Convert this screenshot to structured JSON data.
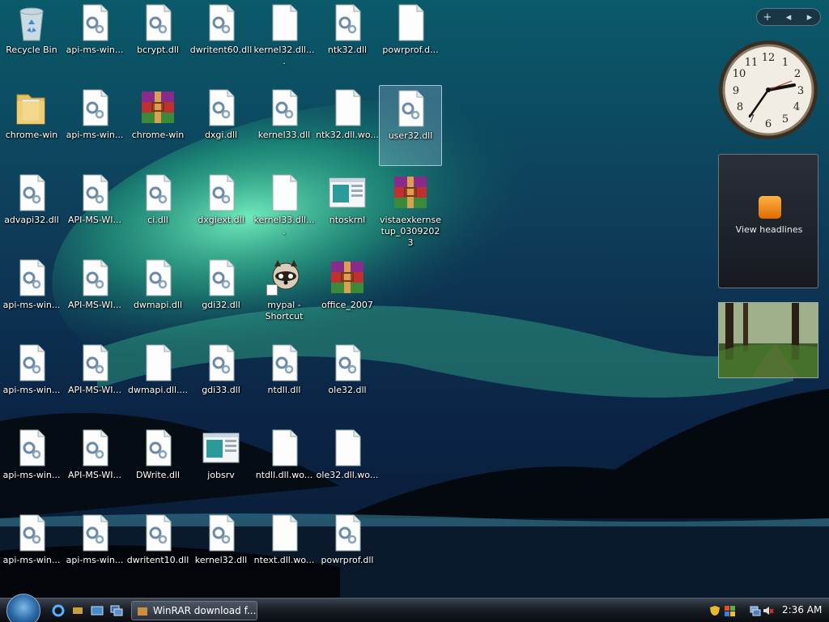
{
  "desktop": {
    "icons": [
      {
        "label": "Recycle Bin",
        "type": "recycle"
      },
      {
        "label": "api-ms-win...",
        "type": "dll"
      },
      {
        "label": "bcrypt.dll",
        "type": "dll"
      },
      {
        "label": "dwritent60.dll",
        "type": "dll"
      },
      {
        "label": "kernel32.dll....",
        "type": "blank"
      },
      {
        "label": "ntk32.dll",
        "type": "dll"
      },
      {
        "label": "powrprof.d...",
        "type": "blank"
      },
      {
        "label": "chrome-win",
        "type": "folder"
      },
      {
        "label": "api-ms-win...",
        "type": "dll"
      },
      {
        "label": "chrome-win",
        "type": "rar"
      },
      {
        "label": "dxgi.dll",
        "type": "dll"
      },
      {
        "label": "kernel33.dll",
        "type": "dll"
      },
      {
        "label": "ntk32.dll.wo...",
        "type": "blank"
      },
      {
        "label": "user32.dll",
        "type": "dll",
        "selected": true
      },
      {
        "label": "advapi32.dll",
        "type": "dll"
      },
      {
        "label": "API-MS-WI...",
        "type": "dll"
      },
      {
        "label": "ci.dll",
        "type": "dll"
      },
      {
        "label": "dxgiext.dll",
        "type": "dll"
      },
      {
        "label": "kernel33.dll....",
        "type": "blank"
      },
      {
        "label": "ntoskrnl",
        "type": "window"
      },
      {
        "label": "vistaexkernsetup_03092023",
        "type": "rar"
      },
      {
        "label": "api-ms-win...",
        "type": "dll"
      },
      {
        "label": "API-MS-WI...",
        "type": "dll"
      },
      {
        "label": "dwmapi.dll",
        "type": "dll"
      },
      {
        "label": "gdi32.dll",
        "type": "dll"
      },
      {
        "label": "mypal - Shortcut",
        "type": "raccoon"
      },
      {
        "label": "office_2007",
        "type": "rar"
      },
      {
        "label": "api-ms-win...",
        "type": "dll"
      },
      {
        "label": "API-MS-WI...",
        "type": "dll"
      },
      {
        "label": "dwmapi.dll....",
        "type": "blank"
      },
      {
        "label": "gdi33.dll",
        "type": "dll"
      },
      {
        "label": "ntdll.dll",
        "type": "dll"
      },
      {
        "label": "ole32.dll",
        "type": "dll"
      },
      {
        "label": "api-ms-win...",
        "type": "dll"
      },
      {
        "label": "API-MS-WI...",
        "type": "dll"
      },
      {
        "label": "DWrite.dll",
        "type": "dll"
      },
      {
        "label": "jobsrv",
        "type": "window"
      },
      {
        "label": "ntdll.dll.wo...",
        "type": "blank"
      },
      {
        "label": "ole32.dll.wo...",
        "type": "blank"
      },
      {
        "label": "api-ms-win...",
        "type": "dll"
      },
      {
        "label": "api-ms-win...",
        "type": "dll"
      },
      {
        "label": "dwritent10.dll",
        "type": "dll"
      },
      {
        "label": "kernel32.dll",
        "type": "dll"
      },
      {
        "label": "ntext.dll.wo...",
        "type": "blank"
      },
      {
        "label": "powrprof.dll",
        "type": "dll"
      }
    ]
  },
  "sidebar": {
    "controls": {
      "add": "+",
      "prev": "◂",
      "next": "▸"
    },
    "feed": {
      "label": "View headlines"
    }
  },
  "taskbar": {
    "tasks": [
      {
        "label": "WinRAR download f..."
      }
    ],
    "clock": "2:36 AM"
  },
  "colors": {
    "accent": "#2a6aa8",
    "selection": "#aac8e6"
  }
}
